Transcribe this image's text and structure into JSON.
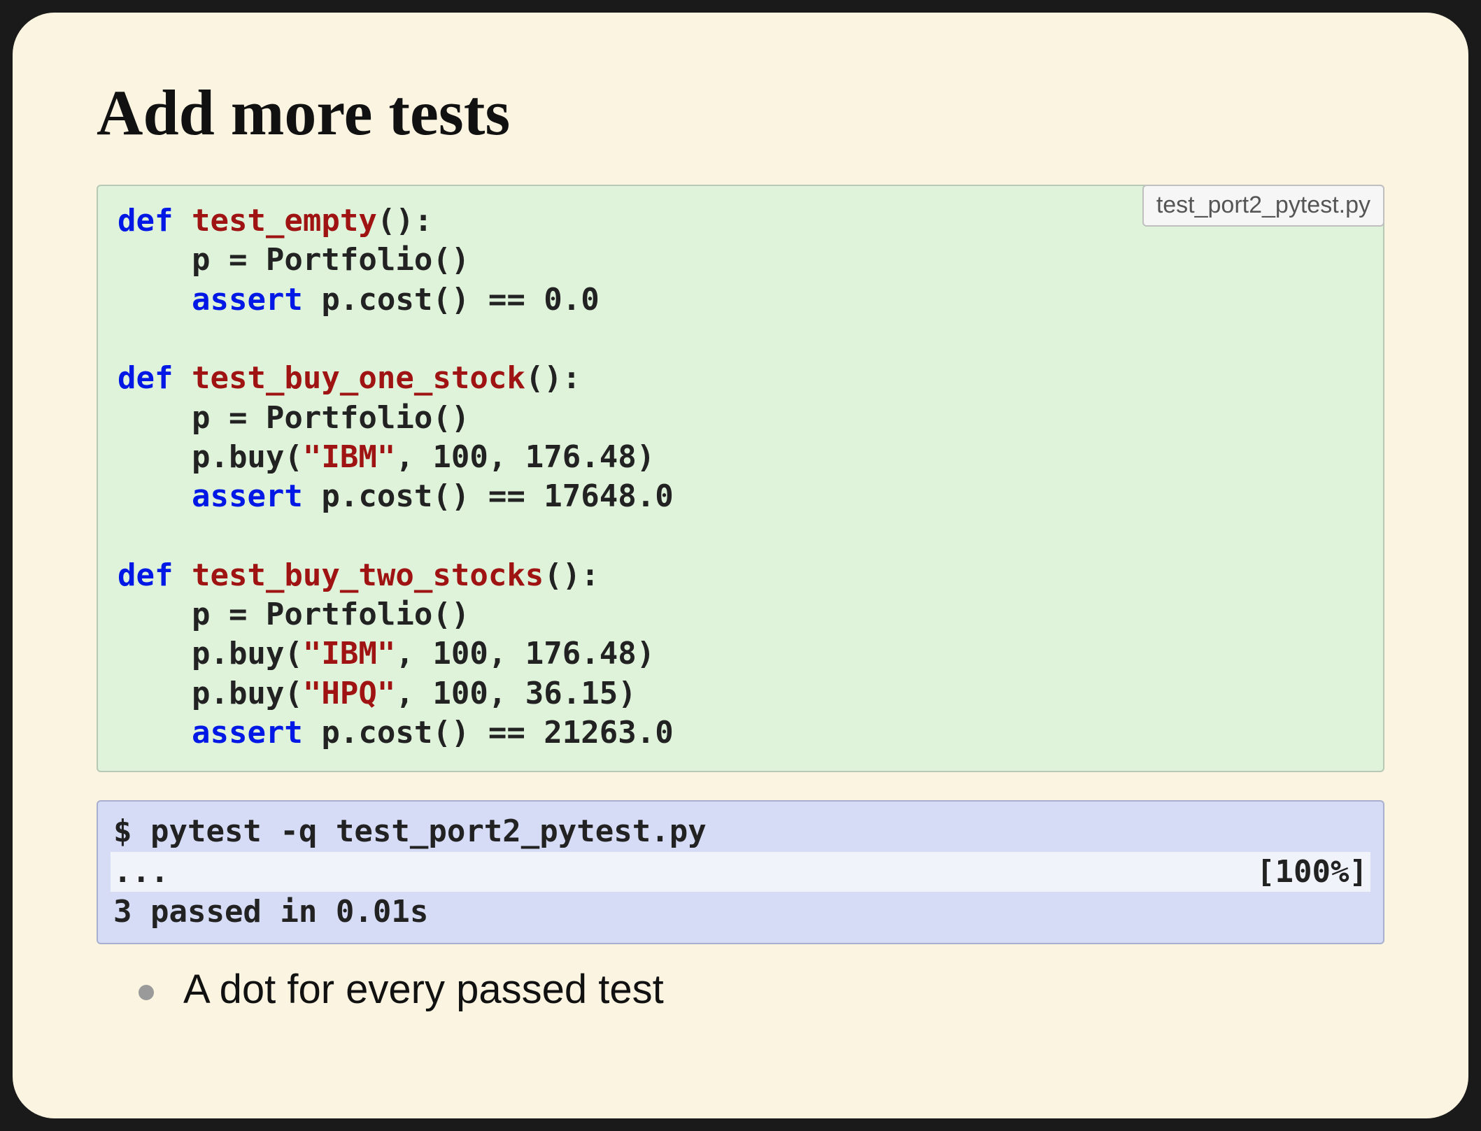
{
  "title": "Add more tests",
  "code": {
    "filename": "test_port2_pytest.py",
    "kw_def": "def",
    "kw_assert": "assert",
    "fn1": "test_empty",
    "fn2": "test_buy_one_stock",
    "fn3": "test_buy_two_stocks",
    "l1_1_tail": "():",
    "l1_2": "    p = Portfolio()",
    "l1_3a": "    ",
    "l1_3b": " p.cost() == 0.0",
    "l2_1_tail": "():",
    "l2_2": "    p = Portfolio()",
    "l2_3a": "    p.buy(",
    "l2_3s": "\"IBM\"",
    "l2_3b": ", 100, 176.48)",
    "l2_4a": "    ",
    "l2_4b": " p.cost() == 17648.0",
    "l3_1_tail": "():",
    "l3_2": "    p = Portfolio()",
    "l3_3a": "    p.buy(",
    "l3_3s": "\"IBM\"",
    "l3_3b": ", 100, 176.48)",
    "l3_4a": "    p.buy(",
    "l3_4s": "\"HPQ\"",
    "l3_4b": ", 100, 36.15)",
    "l3_5a": "    ",
    "l3_5b": " p.cost() == 21263.0"
  },
  "term": {
    "line1": "$ pytest -q test_port2_pytest.py",
    "line2_left": "...",
    "line2_right": "[100%]",
    "line3": "3 passed in 0.01s"
  },
  "bullet1": "A dot for every passed test"
}
